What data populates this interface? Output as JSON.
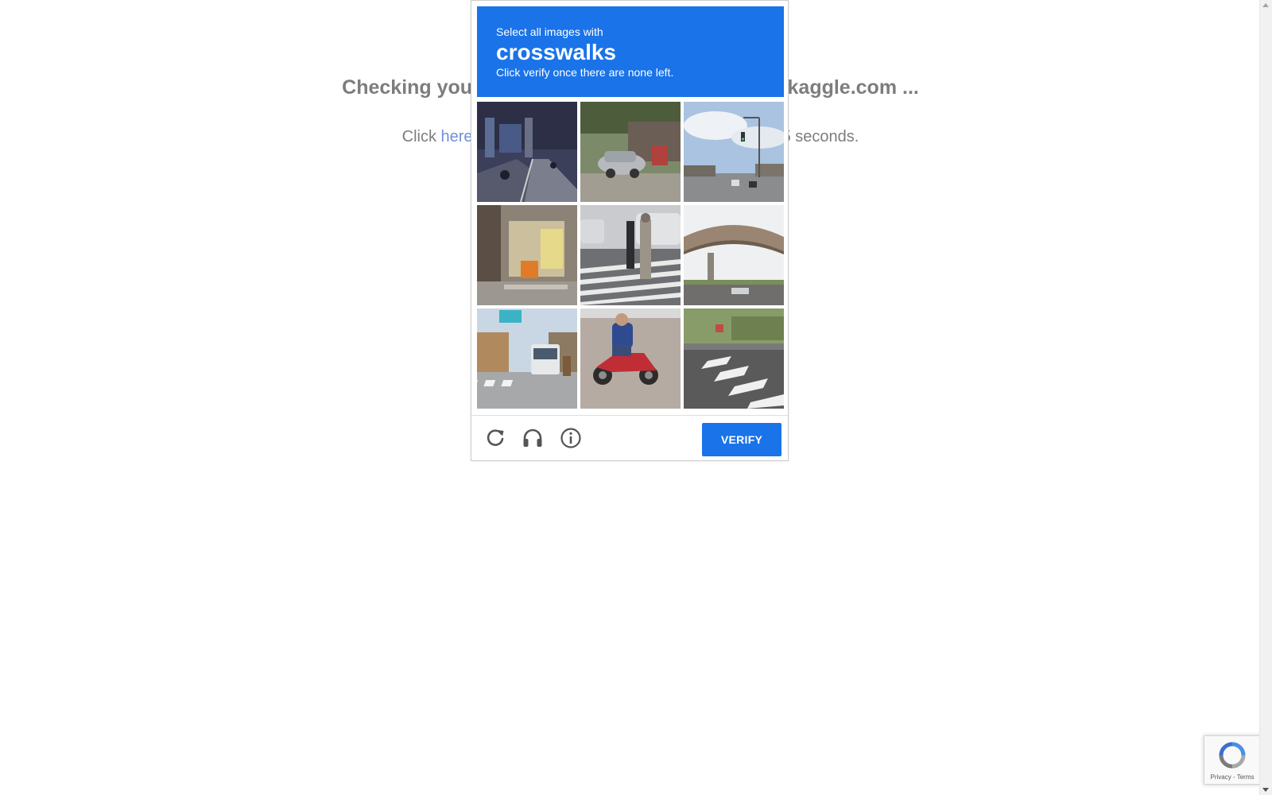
{
  "background": {
    "heading": "Checking your browser before accessing www.kaggle.com ...",
    "sub_prefix": "Click ",
    "sub_link": "here",
    "sub_suffix": " if you are not automatically redirected after 5 seconds."
  },
  "challenge": {
    "instruction": "Select all images with",
    "keyword": "crosswalks",
    "hint": "Click verify once there are none left.",
    "tiles": [
      {
        "icon": "street-scene-scooters"
      },
      {
        "icon": "parked-car-storefront"
      },
      {
        "icon": "road-traffic-light"
      },
      {
        "icon": "market-stall"
      },
      {
        "icon": "pedestrians-crosswalk"
      },
      {
        "icon": "overpass-bridge"
      },
      {
        "icon": "bus-crosswalk"
      },
      {
        "icon": "motorcycle-rider"
      },
      {
        "icon": "intersection-crosswalk"
      }
    ],
    "footer": {
      "reload_icon": "reload-icon",
      "audio_icon": "headphones-icon",
      "info_icon": "info-icon",
      "verify_label": "VERIFY"
    },
    "accent_color": "#1a73e8"
  },
  "badge": {
    "links": "Privacy - Terms"
  }
}
